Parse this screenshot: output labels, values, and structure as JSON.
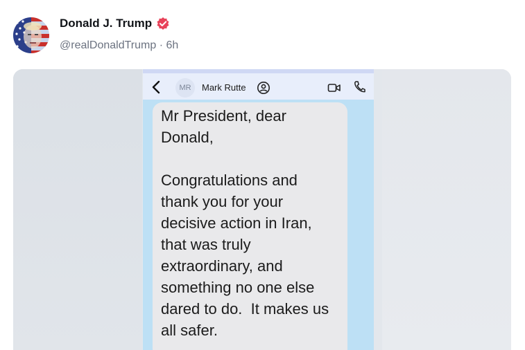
{
  "post": {
    "author_name": "Donald J. Trump",
    "handle_time": "@realDonaldTrump · 6h"
  },
  "chat": {
    "contact_initials": "MR",
    "contact_name": "Mark Rutte",
    "message": "Mr President, dear\nDonald,\n\nCongratulations and\nthank you for your\ndecisive action in Iran,\nthat was truly\nextraordinary, and\nsomething no one else\ndared to do.  It makes us\nall safer."
  },
  "colors": {
    "verified_badge": "#e8435a",
    "chat_background": "#bde0f5",
    "bubble": "#e9e9eb"
  },
  "icons": [
    "verified-badge-icon",
    "chevron-left-icon",
    "contact-card-icon",
    "video-camera-icon",
    "phone-icon"
  ]
}
